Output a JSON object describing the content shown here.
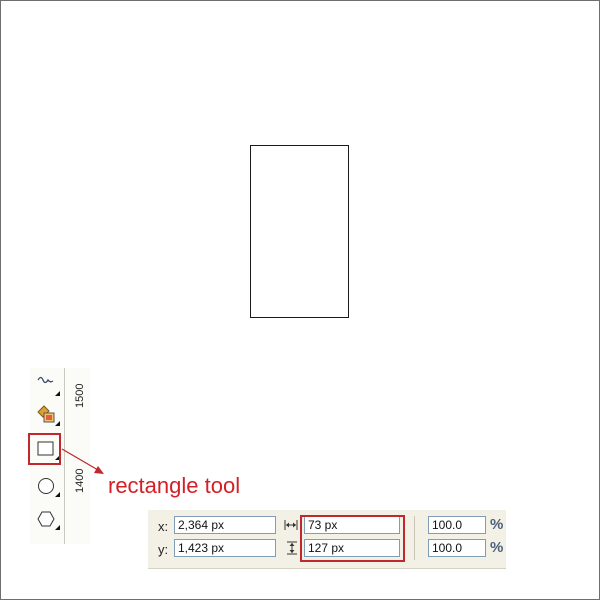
{
  "toolbox": {
    "ruler_label_top": "1500",
    "ruler_label_bottom": "1400",
    "tools": [
      {
        "name": "freehand",
        "icon": "freehand-curve-icon"
      },
      {
        "name": "smart-fill",
        "icon": "smart-fill-icon"
      },
      {
        "name": "rectangle",
        "icon": "rectangle-icon",
        "selected": true
      },
      {
        "name": "ellipse",
        "icon": "ellipse-icon"
      },
      {
        "name": "polygon",
        "icon": "polygon-icon"
      }
    ]
  },
  "callout": {
    "label": "rectangle tool",
    "color": "#d41f26"
  },
  "property_bar": {
    "x_label": "x:",
    "x_value": "2,364 px",
    "y_label": "y:",
    "y_value": "1,423 px",
    "width_value": "73 px",
    "height_value": "127 px",
    "scale_x_value": "100.0",
    "scale_y_value": "100.0",
    "percent_symbol": "%",
    "width_icon": "horizontal-resize-icon",
    "height_icon": "vertical-resize-icon"
  },
  "colors": {
    "highlight": "#c0282d",
    "bar_background": "#f3f1e6",
    "input_border": "#7f9db9"
  }
}
